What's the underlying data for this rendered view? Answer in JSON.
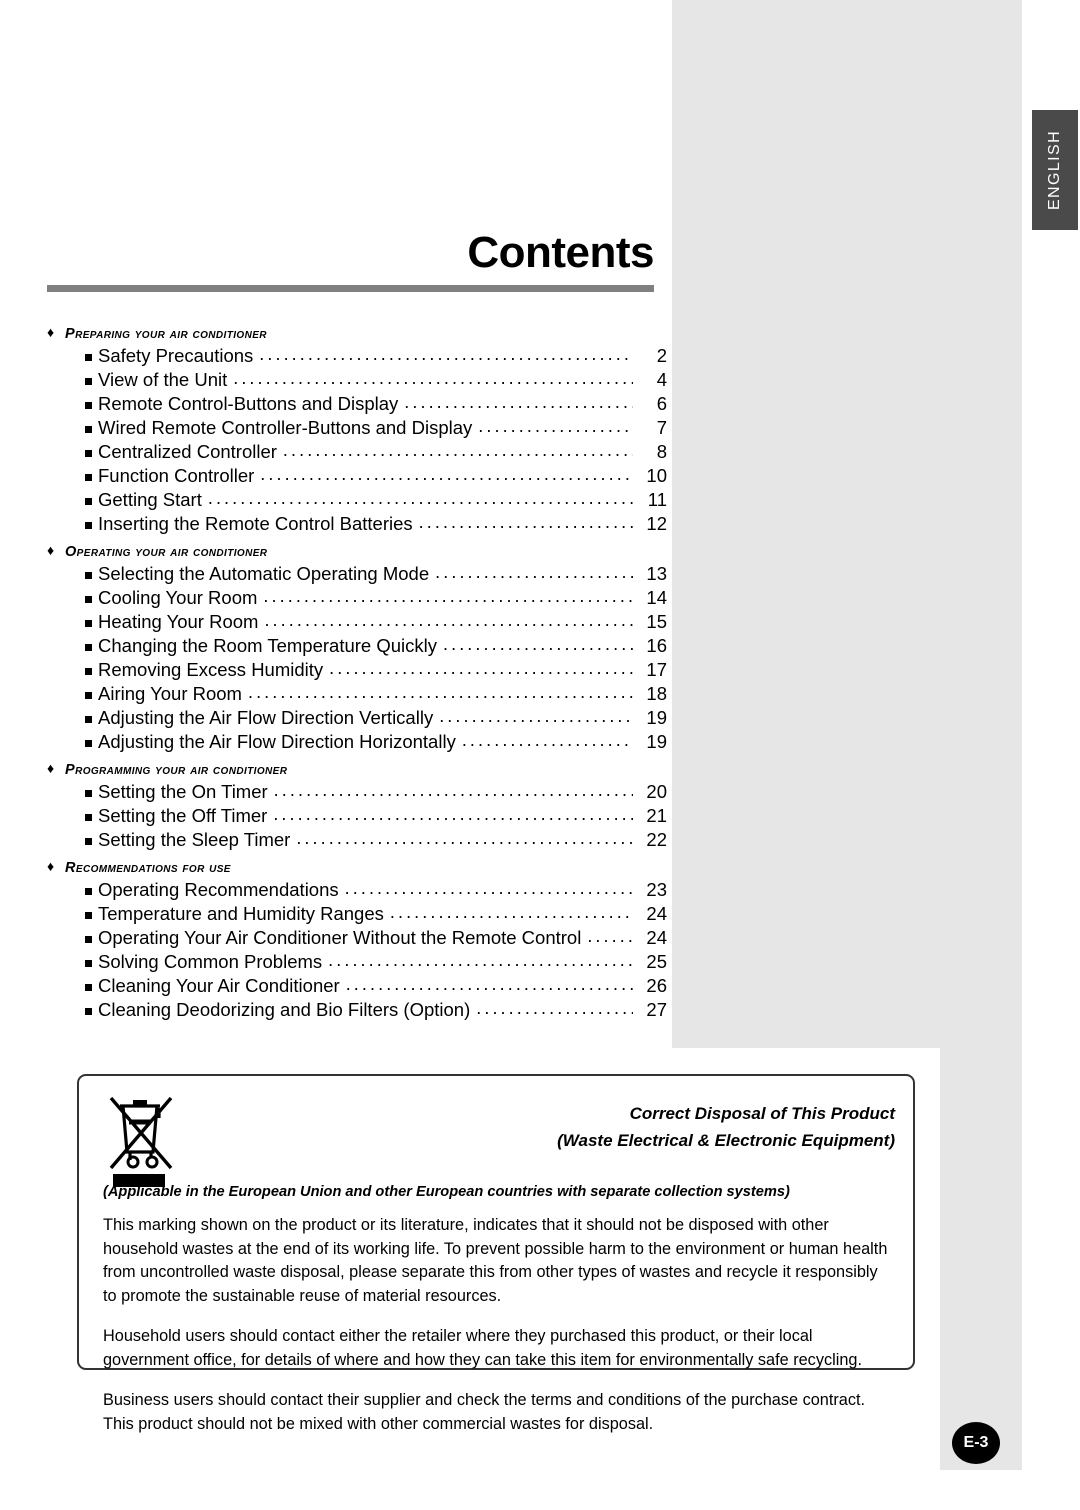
{
  "side_tab": {
    "label": "ENGLISH"
  },
  "page_title": "Contents",
  "page_badge": "E-3",
  "toc": {
    "sections": [
      {
        "bullet": "♦",
        "title": "Preparing your air conditioner",
        "items": [
          {
            "bullet": "■",
            "label": "Safety Precautions",
            "page": "2"
          },
          {
            "bullet": "■",
            "label": "View of the Unit",
            "page": "4"
          },
          {
            "bullet": "■",
            "label": "Remote Control-Buttons and Display",
            "page": "6"
          },
          {
            "bullet": "■",
            "label": "Wired Remote Controller-Buttons and Display",
            "page": "7"
          },
          {
            "bullet": "■",
            "label": "Centralized Controller",
            "page": "8"
          },
          {
            "bullet": "■",
            "label": "Function Controller",
            "page": "10"
          },
          {
            "bullet": "■",
            "label": "Getting Start",
            "page": "11"
          },
          {
            "bullet": "■",
            "label": "Inserting the Remote Control Batteries",
            "page": "12"
          }
        ]
      },
      {
        "bullet": "♦",
        "title": "Operating your air conditioner",
        "items": [
          {
            "bullet": "■",
            "label": "Selecting the Automatic Operating Mode",
            "page": "13"
          },
          {
            "bullet": "■",
            "label": "Cooling Your Room",
            "page": "14"
          },
          {
            "bullet": "■",
            "label": "Heating Your Room",
            "page": "15"
          },
          {
            "bullet": "■",
            "label": "Changing the Room Temperature Quickly",
            "page": "16"
          },
          {
            "bullet": "■",
            "label": "Removing Excess Humidity",
            "page": "17"
          },
          {
            "bullet": "■",
            "label": "Airing Your Room",
            "page": "18"
          },
          {
            "bullet": "■",
            "label": "Adjusting the Air Flow Direction Vertically",
            "page": "19"
          },
          {
            "bullet": "■",
            "label": "Adjusting the Air Flow Direction Horizontally",
            "page": "19"
          }
        ]
      },
      {
        "bullet": "♦",
        "title": "Programming your air conditioner",
        "items": [
          {
            "bullet": "■",
            "label": "Setting the On Timer",
            "page": "20"
          },
          {
            "bullet": "■",
            "label": "Setting the Off Timer",
            "page": "21"
          },
          {
            "bullet": "■",
            "label": "Setting the Sleep Timer",
            "page": "22"
          }
        ]
      },
      {
        "bullet": "♦",
        "title": "Recommendations for use",
        "items": [
          {
            "bullet": "■",
            "label": "Operating Recommendations",
            "page": "23"
          },
          {
            "bullet": "■",
            "label": "Temperature and Humidity Ranges",
            "page": "24"
          },
          {
            "bullet": "■",
            "label": "Operating Your Air Conditioner Without the Remote Control",
            "page": "24"
          },
          {
            "bullet": "■",
            "label": "Solving Common Problems",
            "page": "25"
          },
          {
            "bullet": "■",
            "label": "Cleaning Your Air Conditioner",
            "page": "26"
          },
          {
            "bullet": "■",
            "label": "Cleaning Deodorizing and Bio Filters (Option)",
            "page": "27"
          }
        ]
      }
    ]
  },
  "weee": {
    "icon_name": "crossed-out-wheeled-bin-icon",
    "heading_line1": "Correct Disposal of This Product",
    "heading_line2": "(Waste Electrical & Electronic Equipment)",
    "applicability": "(Applicable in the European Union and other European countries with separate collection systems)",
    "paragraphs": [
      "This marking shown on the product or its literature, indicates that it should not be disposed with other household wastes at the end of its working life. To prevent possible harm to the environment or human health from uncontrolled waste disposal, please separate this from other types of wastes and recycle it responsibly to promote the sustainable reuse of material resources.",
      "Household users should contact either the retailer where they purchased this product, or their local government office, for details of where and how they can take this item for environmentally safe recycling.",
      "Business users should contact their supplier and check the terms and conditions of the purchase contract. This product should not be mixed with other commercial wastes for disposal."
    ]
  },
  "colors": {
    "gray_panel": "#e6e6e6",
    "tab_background": "#4a4a4a",
    "title_rule": "#808080",
    "box_border": "#333333",
    "badge_background": "#000000"
  }
}
